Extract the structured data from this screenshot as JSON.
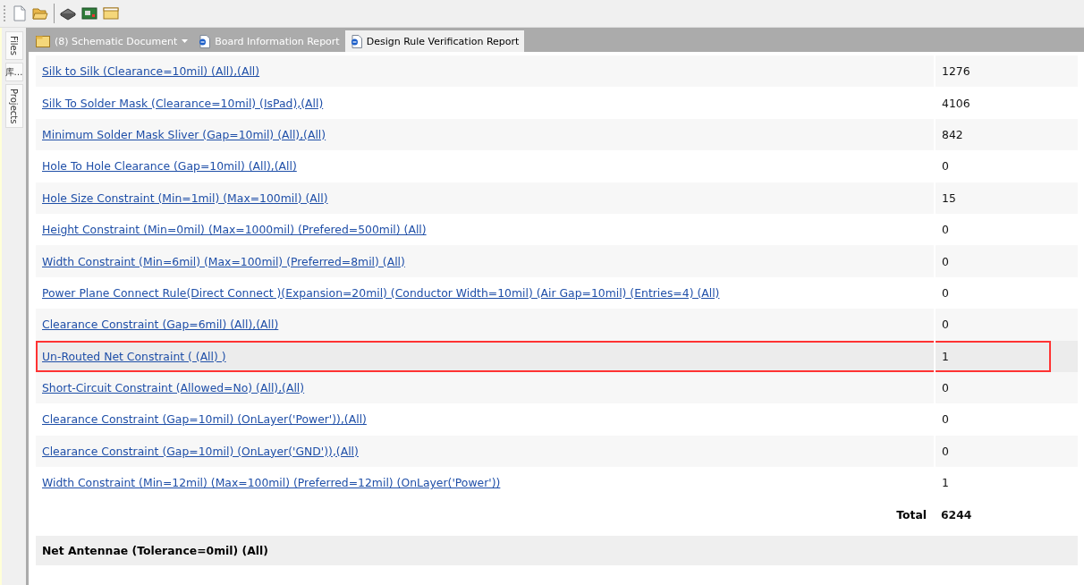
{
  "side_panel": {
    "tabs": [
      {
        "label": "Files",
        "kind": "rotated"
      },
      {
        "label": "库…",
        "kind": "stacked"
      },
      {
        "label": "Projects",
        "kind": "rotated"
      }
    ]
  },
  "document_tabs": [
    {
      "label": "(8) Schematic Document",
      "kind": "folder",
      "dropdown": true,
      "selected": false
    },
    {
      "label": "Board Information Report",
      "kind": "report",
      "dropdown": false,
      "selected": false
    },
    {
      "label": "Design Rule Verification Report",
      "kind": "report",
      "dropdown": false,
      "selected": true
    }
  ],
  "rules_table": {
    "rows": [
      {
        "rule": "Silk to Silk (Clearance=10mil) (All),(All)",
        "count": "1276",
        "highlighted": false
      },
      {
        "rule": "Silk To Solder Mask (Clearance=10mil) (IsPad),(All)",
        "count": "4106",
        "highlighted": false
      },
      {
        "rule": "Minimum Solder Mask Sliver (Gap=10mil) (All),(All)",
        "count": "842",
        "highlighted": false
      },
      {
        "rule": "Hole To Hole Clearance (Gap=10mil) (All),(All)",
        "count": "0",
        "highlighted": false
      },
      {
        "rule": "Hole Size Constraint (Min=1mil) (Max=100mil) (All)",
        "count": "15",
        "highlighted": false
      },
      {
        "rule": "Height Constraint (Min=0mil) (Max=1000mil) (Prefered=500mil) (All)",
        "count": "0",
        "highlighted": false
      },
      {
        "rule": "Width Constraint (Min=6mil) (Max=100mil) (Preferred=8mil) (All)",
        "count": "0",
        "highlighted": false
      },
      {
        "rule": "Power Plane Connect Rule(Direct Connect )(Expansion=20mil) (Conductor Width=10mil) (Air Gap=10mil) (Entries=4) (All)",
        "count": "0",
        "highlighted": false
      },
      {
        "rule": "Clearance Constraint (Gap=6mil) (All),(All)",
        "count": "0",
        "highlighted": false
      },
      {
        "rule": "Un-Routed Net Constraint ( (All) )",
        "count": "1",
        "highlighted": true
      },
      {
        "rule": "Short-Circuit Constraint (Allowed=No) (All),(All)",
        "count": "0",
        "highlighted": false
      },
      {
        "rule": "Clearance Constraint (Gap=10mil) (OnLayer('Power')),(All)",
        "count": "0",
        "highlighted": false
      },
      {
        "rule": "Clearance Constraint (Gap=10mil) (OnLayer('GND')),(All)",
        "count": "0",
        "highlighted": false
      },
      {
        "rule": "Width Constraint (Min=12mil) (Max=100mil) (Preferred=12mil) (OnLayer('Power'))",
        "count": "1",
        "highlighted": false
      }
    ],
    "total_label": "Total",
    "total": "6244"
  },
  "section_heading": "Net Antennae (Tolerance=0mil) (All)"
}
